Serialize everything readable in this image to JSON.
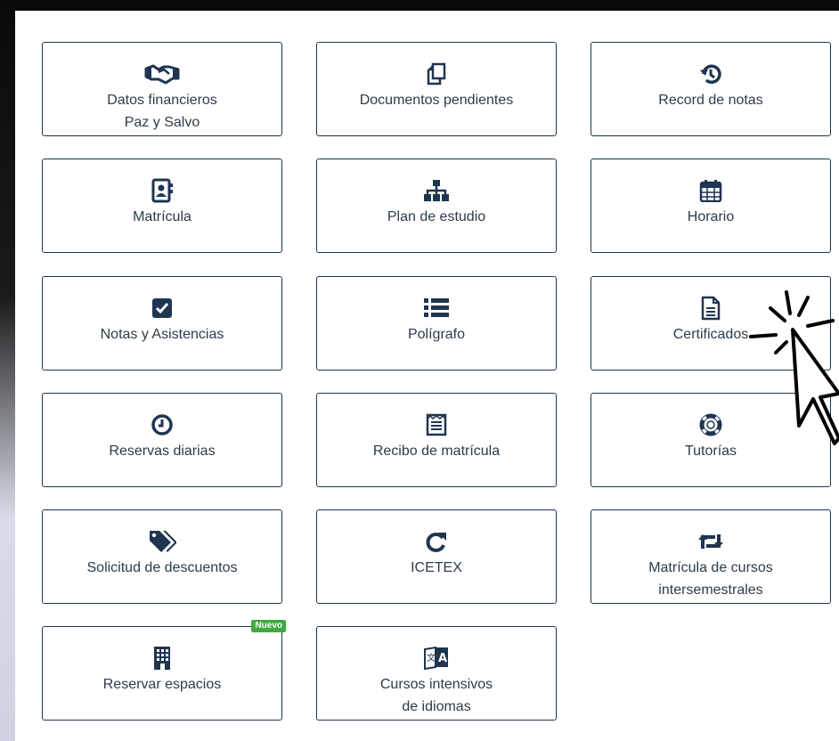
{
  "tiles": [
    {
      "id": "datos-financieros",
      "icon": "handshake-icon",
      "lines": [
        "Datos financieros",
        "Paz y Salvo"
      ]
    },
    {
      "id": "documentos-pendientes",
      "icon": "copy-icon",
      "lines": [
        "Documentos pendientes"
      ]
    },
    {
      "id": "record-notas",
      "icon": "history-icon",
      "lines": [
        "Record de notas"
      ]
    },
    {
      "id": "matricula",
      "icon": "address-book-icon",
      "lines": [
        "Matrícula"
      ]
    },
    {
      "id": "plan-estudio",
      "icon": "sitemap-icon",
      "lines": [
        "Plan de estudio"
      ]
    },
    {
      "id": "horario",
      "icon": "calendar-icon",
      "lines": [
        "Horario"
      ]
    },
    {
      "id": "notas-asistencias",
      "icon": "check-square-icon",
      "lines": [
        "Notas y Asistencias"
      ]
    },
    {
      "id": "poligrafo",
      "icon": "list-icon",
      "lines": [
        "Polígrafo"
      ]
    },
    {
      "id": "certificados",
      "icon": "file-text-icon",
      "lines": [
        "Certificados"
      ]
    },
    {
      "id": "reservas-diarias",
      "icon": "clock-icon",
      "lines": [
        "Reservas diarias"
      ]
    },
    {
      "id": "recibo-matricula",
      "icon": "newspaper-icon",
      "lines": [
        "Recibo de matrícula"
      ]
    },
    {
      "id": "tutorias",
      "icon": "life-ring-icon",
      "lines": [
        "Tutorías"
      ]
    },
    {
      "id": "solicitud-descuentos",
      "icon": "tags-icon",
      "lines": [
        "Solicitud de descuentos"
      ]
    },
    {
      "id": "icetex",
      "icon": "redo-icon",
      "lines": [
        "ICETEX"
      ]
    },
    {
      "id": "cursos-intersemestrales",
      "icon": "retweet-icon",
      "lines": [
        "Matrícula de cursos",
        "intersemestrales"
      ]
    },
    {
      "id": "reservar-espacios",
      "icon": "building-icon",
      "lines": [
        "Reservar espacios"
      ],
      "badge": "Nuevo"
    },
    {
      "id": "cursos-idiomas",
      "icon": "language-icon",
      "lines": [
        "Cursos intensivos",
        "de idiomas"
      ]
    }
  ],
  "colors": {
    "icon": "#1f3550",
    "border": "#1f3550",
    "badge": "#3faa3f"
  }
}
